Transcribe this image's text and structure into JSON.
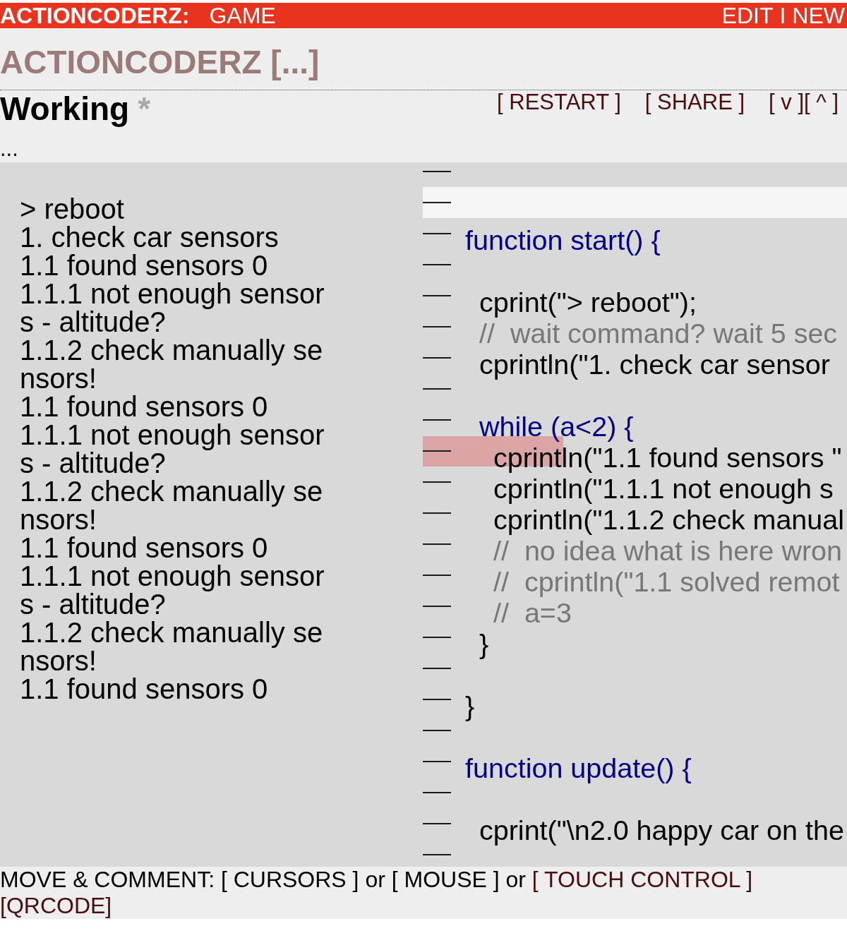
{
  "top_bar": {
    "brand": "ACTIONCODERZ:",
    "section": "GAME",
    "links": [
      "EDIT",
      "NEW"
    ],
    "separator": "I"
  },
  "title": "ACTIONCODERZ [...]",
  "status": {
    "label": "Working",
    "mark": "*",
    "actions": [
      "[ RESTART ]",
      "[ SHARE ]"
    ],
    "scroll_buttons": [
      "[ v ]",
      "[ ^ ]"
    ]
  },
  "progress": "...",
  "console": {
    "lines": [
      "> reboot",
      "1. check car sensors",
      "1.1 found sensors 0",
      "1.1.1 not enough sensors - altitude?",
      "1.1.2 check manually sensors!",
      "1.1 found sensors 0",
      "1.1.1 not enough sensors - altitude?",
      "1.1.2 check manually sensors!",
      "1.1 found sensors 0",
      "1.1.1 not enough sensors - altitude?",
      "1.1.2 check manually sensors!",
      "1.1 found sensors 0"
    ]
  },
  "code": {
    "lines": [
      {
        "kind": "blank",
        "selected": false,
        "running": false
      },
      {
        "kind": "blank",
        "selected": true,
        "running": false
      },
      {
        "kind": "keyword",
        "text": "function start() {",
        "selected": false,
        "running": false,
        "children": [
          {
            "kind": "blank",
            "selected": false,
            "running": false
          },
          {
            "kind": "statement",
            "text": "cprint(\"> reboot\");",
            "selected": false,
            "running": false
          },
          {
            "kind": "comment",
            "text": "//  wait command? wait 5 sec",
            "selected": false,
            "running": false
          },
          {
            "kind": "statement",
            "text": "cprintln(\"1. check car sensor",
            "selected": false,
            "running": false
          },
          {
            "kind": "blank",
            "selected": false,
            "running": false
          },
          {
            "kind": "keyword",
            "text": "while (a<2) {",
            "selected": false,
            "running": false,
            "children": [
              {
                "kind": "statement",
                "text": "cprintln(\"1.1 found sensors \"",
                "selected": false,
                "running": true
              },
              {
                "kind": "statement",
                "text": "cprintln(\"1.1.1 not enough s",
                "selected": false,
                "running": false
              },
              {
                "kind": "statement",
                "text": "cprintln(\"1.1.2 check manual",
                "selected": false,
                "running": false
              },
              {
                "kind": "comment",
                "text": "//  no idea what is here wron",
                "selected": false,
                "running": false
              },
              {
                "kind": "comment",
                "text": "//  cprintln(\"1.1 solved remot",
                "selected": false,
                "running": false
              },
              {
                "kind": "comment",
                "text": "//  a=3",
                "selected": false,
                "running": false
              }
            ]
          },
          {
            "kind": "statement",
            "text": "}",
            "selected": false,
            "running": false
          },
          {
            "kind": "blank",
            "selected": false,
            "running": false
          }
        ]
      },
      {
        "kind": "statement",
        "text": "}",
        "selected": false,
        "running": false
      },
      {
        "kind": "blank",
        "selected": false,
        "running": false
      },
      {
        "kind": "keyword",
        "text": "function update() {",
        "selected": false,
        "running": false,
        "children": [
          {
            "kind": "blank",
            "selected": false,
            "running": false
          },
          {
            "kind": "statement",
            "text": "cprint(\"\\n2.0 happy car on the",
            "selected": false,
            "running": false
          },
          {
            "kind": "blank",
            "selected": false,
            "running": false
          }
        ]
      }
    ]
  },
  "footer": {
    "hint": "MOVE & COMMENT: [ CURSORS ] or [ MOUSE ] or",
    "links": [
      "[ TOUCH CONTROL ]",
      "[QRCODE]"
    ]
  }
}
